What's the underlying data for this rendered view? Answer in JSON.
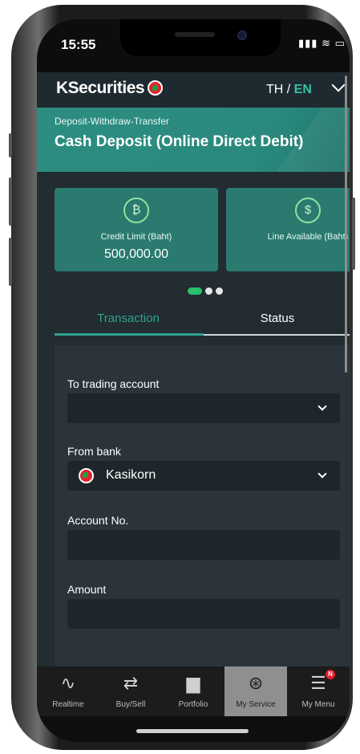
{
  "status_bar": {
    "time": "15:55",
    "icons": "..ıl ᯤ ▬"
  },
  "header": {
    "brand": "KSecurities",
    "lang_th": "TH",
    "lang_sep": " / ",
    "lang_en": "EN"
  },
  "hero": {
    "subtitle": "Deposit-Withdraw-Transfer",
    "title": "Cash Deposit (Online Direct Debit)"
  },
  "cards": [
    {
      "label": "Credit Limit (Baht)",
      "value": "500,000.00",
      "icon": "money-icon"
    },
    {
      "label": "Line Available (Baht)",
      "value": "",
      "icon": "hand-coin-icon"
    }
  ],
  "carousel": {
    "total": 3,
    "active": 0
  },
  "tabs": [
    {
      "label": "Transaction",
      "active": true
    },
    {
      "label": "Status",
      "active": false
    }
  ],
  "form": {
    "trading_account_label": "To trading account",
    "trading_account_value": "",
    "from_bank_label": "From bank",
    "from_bank_value": "Kasikorn",
    "account_no_label": "Account No.",
    "account_no_value": "",
    "amount_label": "Amount",
    "amount_value": ""
  },
  "nav": [
    {
      "label": "Realtime",
      "icon": "chart-line-icon"
    },
    {
      "label": "Buy/Sell",
      "icon": "arrows-exchange-icon"
    },
    {
      "label": "Portfolio",
      "icon": "folder-icon"
    },
    {
      "label": "My Service",
      "icon": "service-icon",
      "active": true
    },
    {
      "label": "My Menu",
      "icon": "user-menu-icon",
      "badge": "N"
    }
  ],
  "colors": {
    "accent": "#2fa290",
    "hero": "#2a8a7e",
    "card": "#2a7a70",
    "background": "#222c31",
    "badge": "#e51d2a"
  }
}
